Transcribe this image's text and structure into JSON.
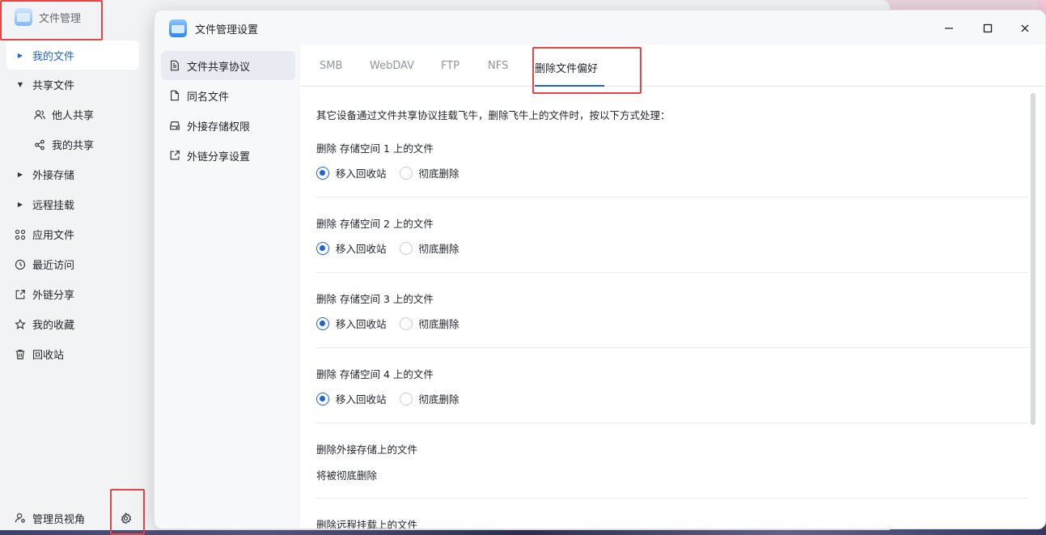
{
  "app": {
    "title": "文件管理"
  },
  "sidebar": {
    "items": [
      {
        "label": "我的文件",
        "icon": "caret-right-icon",
        "active": true
      },
      {
        "label": "共享文件",
        "icon": "caret-down-icon"
      },
      {
        "label": "他人共享",
        "icon": "users-icon"
      },
      {
        "label": "我的共享",
        "icon": "share-icon"
      },
      {
        "label": "外接存储",
        "icon": "caret-right-icon"
      },
      {
        "label": "远程挂载",
        "icon": "caret-right-icon"
      },
      {
        "label": "应用文件",
        "icon": "apps-icon"
      },
      {
        "label": "最近访问",
        "icon": "clock-icon"
      },
      {
        "label": "外链分享",
        "icon": "external-link-icon"
      },
      {
        "label": "我的收藏",
        "icon": "star-icon"
      },
      {
        "label": "回收站",
        "icon": "trash-icon"
      }
    ],
    "admin_label": "管理员视角"
  },
  "dialog": {
    "title": "文件管理设置",
    "nav": [
      {
        "label": "文件共享协议",
        "active": true
      },
      {
        "label": "同名文件"
      },
      {
        "label": "外接存储权限"
      },
      {
        "label": "外链分享设置"
      }
    ],
    "tabs": [
      {
        "label": "SMB"
      },
      {
        "label": "WebDAV"
      },
      {
        "label": "FTP"
      },
      {
        "label": "NFS"
      },
      {
        "label": "删除文件偏好",
        "active": true
      }
    ],
    "intro": "其它设备通过文件共享协议挂载飞牛，删除飞牛上的文件时，按以下方式处理：",
    "groups": [
      {
        "title": "删除 存储空间 1 上的文件",
        "opt1": "移入回收站",
        "opt2": "彻底删除"
      },
      {
        "title": "删除 存储空间 2 上的文件",
        "opt1": "移入回收站",
        "opt2": "彻底删除"
      },
      {
        "title": "删除 存储空间 3 上的文件",
        "opt1": "移入回收站",
        "opt2": "彻底删除"
      },
      {
        "title": "删除 存储空间 4 上的文件",
        "opt1": "移入回收站",
        "opt2": "彻底删除"
      }
    ],
    "external": {
      "title": "删除外接存储上的文件",
      "note": "将被彻底删除"
    },
    "remote": {
      "title": "删除远程挂载上的文件"
    }
  },
  "colors": {
    "accent": "#1d64d8",
    "highlight": "#e64545"
  }
}
